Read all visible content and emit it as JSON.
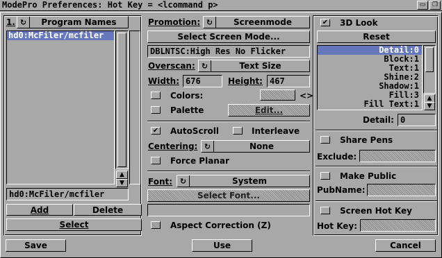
{
  "window": {
    "title": "ModePro Preferences: Hot Key = <lcommand p>"
  },
  "left": {
    "number_label": "1.",
    "cycle_label": "Program Names",
    "list": [
      "hd0:McFiler/mcfiler"
    ],
    "selected_index": 0,
    "path_field": "hd0:McFiler/mcfiler",
    "add_label": "Add",
    "delete_label": "Delete",
    "select_label": "Select"
  },
  "middle": {
    "promotion_label": "Promotion:",
    "promotion_value": "Screenmode",
    "select_screen_mode_label": "Select Screen Mode...",
    "screen_mode_field": "DBLNTSC:High Res No Flicker",
    "overscan_label": "Overscan:",
    "overscan_value": "Text Size",
    "width_label": "Width:",
    "width_value": "676",
    "height_label": "Height:",
    "height_value": "467",
    "colors_label": "Colors:",
    "colors_arrows": "<>",
    "palette_label": "Palette",
    "edit_label": "Edit...",
    "autoscroll_label": "AutoScroll",
    "interleave_label": "Interleave",
    "centering_label": "Centering:",
    "centering_value": "None",
    "force_planar_label": "Force Planar",
    "font_label": "Font:",
    "font_value": "System",
    "select_font_label": "Select Font...",
    "font_field": "",
    "aspect_correction_label": "Aspect Correction (Z)"
  },
  "right": {
    "look3d_label": "3D Look",
    "reset_label": "Reset",
    "pen_list": [
      "Detail:0",
      "Block:1",
      "Text:1",
      "Shine:2",
      "Shadow:1",
      "Fill:3",
      "Fill Text:1"
    ],
    "pen_selected_index": 0,
    "detail_label": "Detail:",
    "detail_value": "0",
    "share_pens_label": "Share Pens",
    "exclude_label": "Exclude:",
    "exclude_value": "",
    "make_public_label": "Make Public",
    "pubname_label": "PubName:",
    "pubname_value": "",
    "screen_hotkey_label": "Screen Hot Key",
    "hotkey_label": "Hot Key:",
    "hotkey_value": ""
  },
  "footer": {
    "save_label": "Save",
    "use_label": "Use",
    "cancel_label": "Cancel"
  },
  "checks": {
    "look3d": true,
    "colors": false,
    "palette": false,
    "autoscroll": true,
    "interleave": false,
    "force_planar": false,
    "aspect_correction": false,
    "share_pens": false,
    "make_public": false,
    "screen_hotkey": false
  },
  "icons": {
    "cycle": "cycle-gadget-icon",
    "checkmark": "checkmark-icon",
    "arrow_up": "arrow-up-icon",
    "arrow_down": "arrow-down-icon",
    "depth": "depth-gadget-icon",
    "zoom": "zoom-gadget-icon"
  },
  "colors": {
    "background": "#a8a8a8",
    "selection": "#6677bb",
    "shine": "#ffffff",
    "shadow": "#000000"
  }
}
